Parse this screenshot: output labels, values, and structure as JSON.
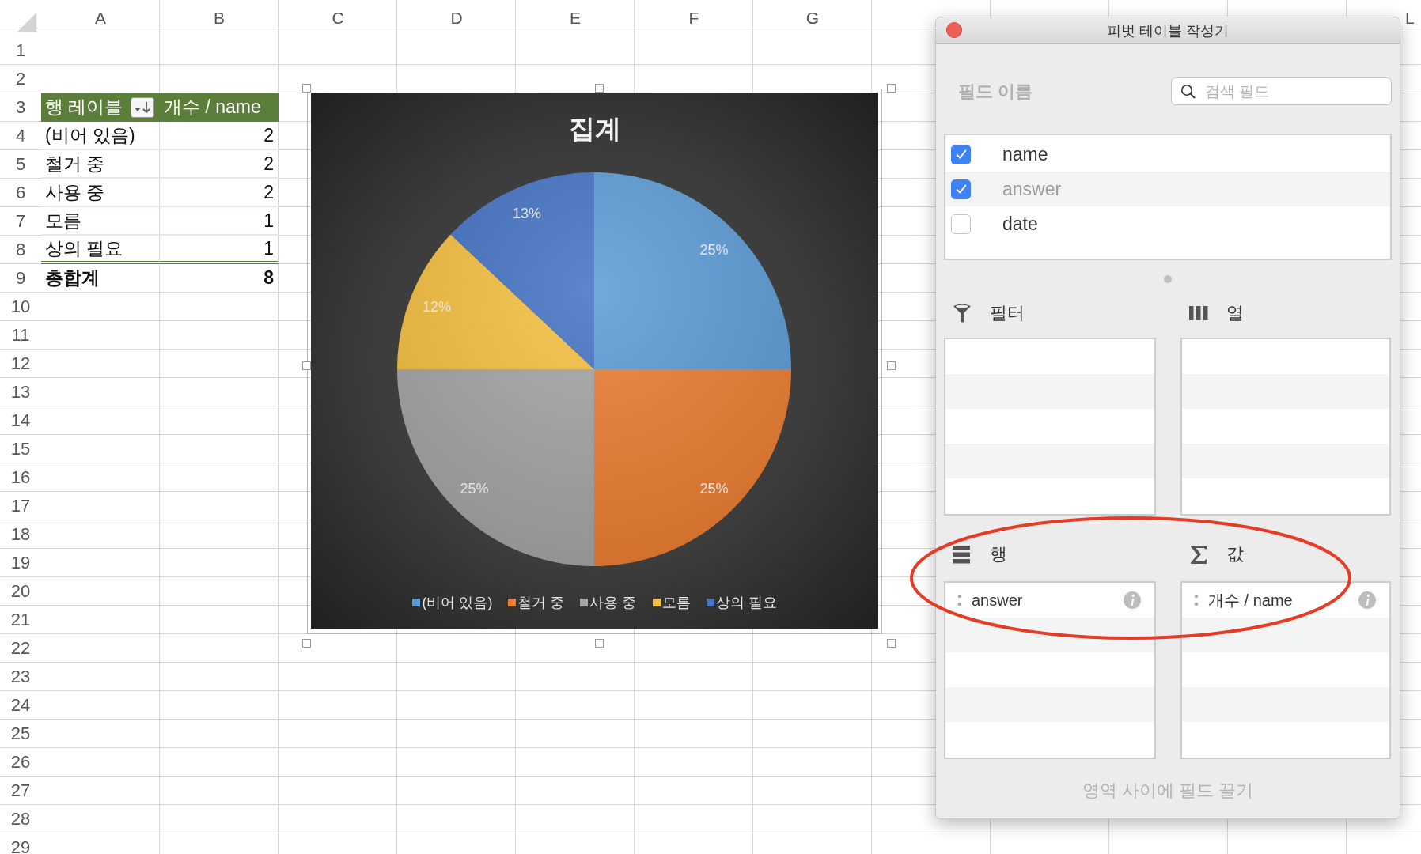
{
  "sheet": {
    "column_headers": [
      "A",
      "B",
      "C",
      "D",
      "E",
      "F",
      "G"
    ],
    "edge_column_header": "L",
    "row_numbers": [
      "1",
      "2",
      "3",
      "4",
      "5",
      "6",
      "7",
      "8",
      "9",
      "10",
      "11",
      "12",
      "13",
      "14",
      "15",
      "16",
      "17",
      "18",
      "19",
      "20",
      "21",
      "22",
      "23",
      "24",
      "25",
      "26",
      "27",
      "28",
      "29"
    ]
  },
  "pivot_table": {
    "row_label_header": "행 레이블",
    "value_header": "개수 / name",
    "rows": [
      {
        "label": "(비어 있음)",
        "value": "2"
      },
      {
        "label": "철거 중",
        "value": "2"
      },
      {
        "label": "사용 중",
        "value": "2"
      },
      {
        "label": "모름",
        "value": "1"
      },
      {
        "label": "상의 필요",
        "value": "1"
      }
    ],
    "total": {
      "label": "총합계",
      "value": "8"
    }
  },
  "chart": {
    "chart_data": {
      "type": "pie",
      "title": "집계",
      "categories": [
        "(비어 있음)",
        "철거 중",
        "사용 중",
        "모름",
        "상의 필요"
      ],
      "values": [
        25,
        25,
        25,
        12,
        13
      ],
      "value_labels": [
        "25%",
        "25%",
        "25%",
        "12%",
        "13%"
      ],
      "legend": "bottom"
    }
  },
  "pivot_builder": {
    "title": "피벗 테이블 작성기",
    "field_list_label": "필드 이름",
    "search": {
      "placeholder": "검색 필드"
    },
    "fields": [
      {
        "name": "name",
        "checked": true,
        "selected": false
      },
      {
        "name": "answer",
        "checked": true,
        "selected": true
      },
      {
        "name": "date",
        "checked": false,
        "selected": false
      }
    ],
    "areas": [
      {
        "kind": "filters",
        "label": "필터"
      },
      {
        "kind": "columns",
        "label": "열"
      },
      {
        "kind": "rows",
        "label": "행",
        "items": [
          "answer"
        ]
      },
      {
        "kind": "values",
        "label": "값",
        "items": [
          "개수 / name"
        ]
      }
    ],
    "hint": "영역 사이에 필드 끌기"
  }
}
